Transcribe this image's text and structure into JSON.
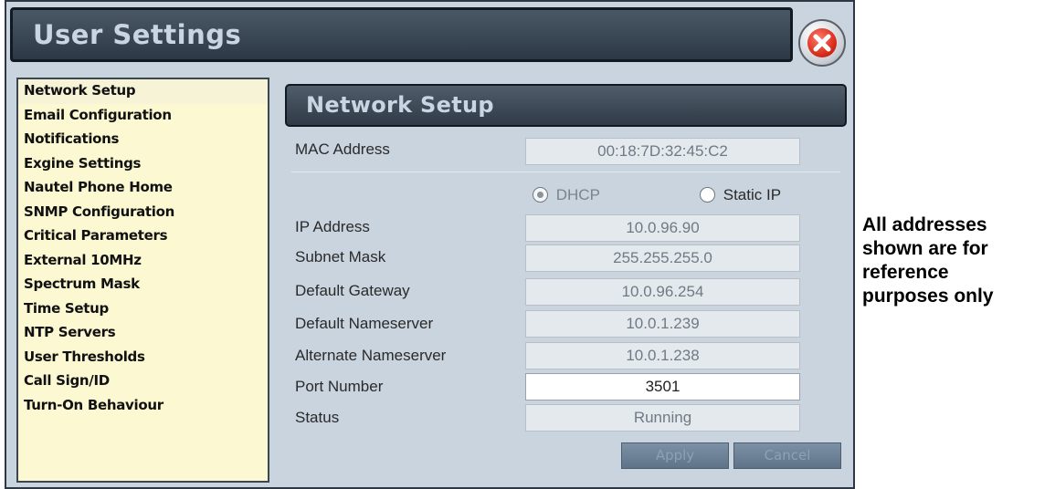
{
  "window": {
    "title": "User Settings"
  },
  "sidebar": {
    "items": [
      {
        "label": "Network Setup"
      },
      {
        "label": "Email Configuration"
      },
      {
        "label": "Notifications"
      },
      {
        "label": "Exgine Settings"
      },
      {
        "label": "Nautel Phone Home"
      },
      {
        "label": "SNMP Configuration"
      },
      {
        "label": "Critical Parameters"
      },
      {
        "label": "External 10MHz"
      },
      {
        "label": "Spectrum Mask"
      },
      {
        "label": "Time Setup"
      },
      {
        "label": "NTP Servers"
      },
      {
        "label": "User Thresholds"
      },
      {
        "label": "Call Sign/ID"
      },
      {
        "label": "Turn-On Behaviour"
      }
    ]
  },
  "panel": {
    "title": "Network Setup",
    "mac": {
      "label": "MAC Address",
      "value": "00:18:7D:32:45:C2"
    },
    "mode": {
      "dhcp_label": "DHCP",
      "static_label": "Static IP",
      "selected": "DHCP"
    },
    "ip": {
      "label": "IP Address",
      "value": "10.0.96.90"
    },
    "subnet": {
      "label": "Subnet Mask",
      "value": "255.255.255.0"
    },
    "gateway": {
      "label": "Default Gateway",
      "value": "10.0.96.254"
    },
    "dns1": {
      "label": "Default Nameserver",
      "value": "10.0.1.239"
    },
    "dns2": {
      "label": "Alternate Nameserver",
      "value": "10.0.1.238"
    },
    "port": {
      "label": "Port Number",
      "value": "3501"
    },
    "status": {
      "label": "Status",
      "value": "Running"
    },
    "apply_label": "Apply",
    "cancel_label": "Cancel"
  },
  "note": {
    "line1": "All addresses",
    "line2": "shown are for",
    "line3": "reference",
    "line4": "purposes only"
  },
  "colors": {
    "window_bg": "#c9d4de",
    "titlebar": "#2c3845",
    "sidebar_bg": "#fcf9d2",
    "close_red": "#d62a1a"
  }
}
